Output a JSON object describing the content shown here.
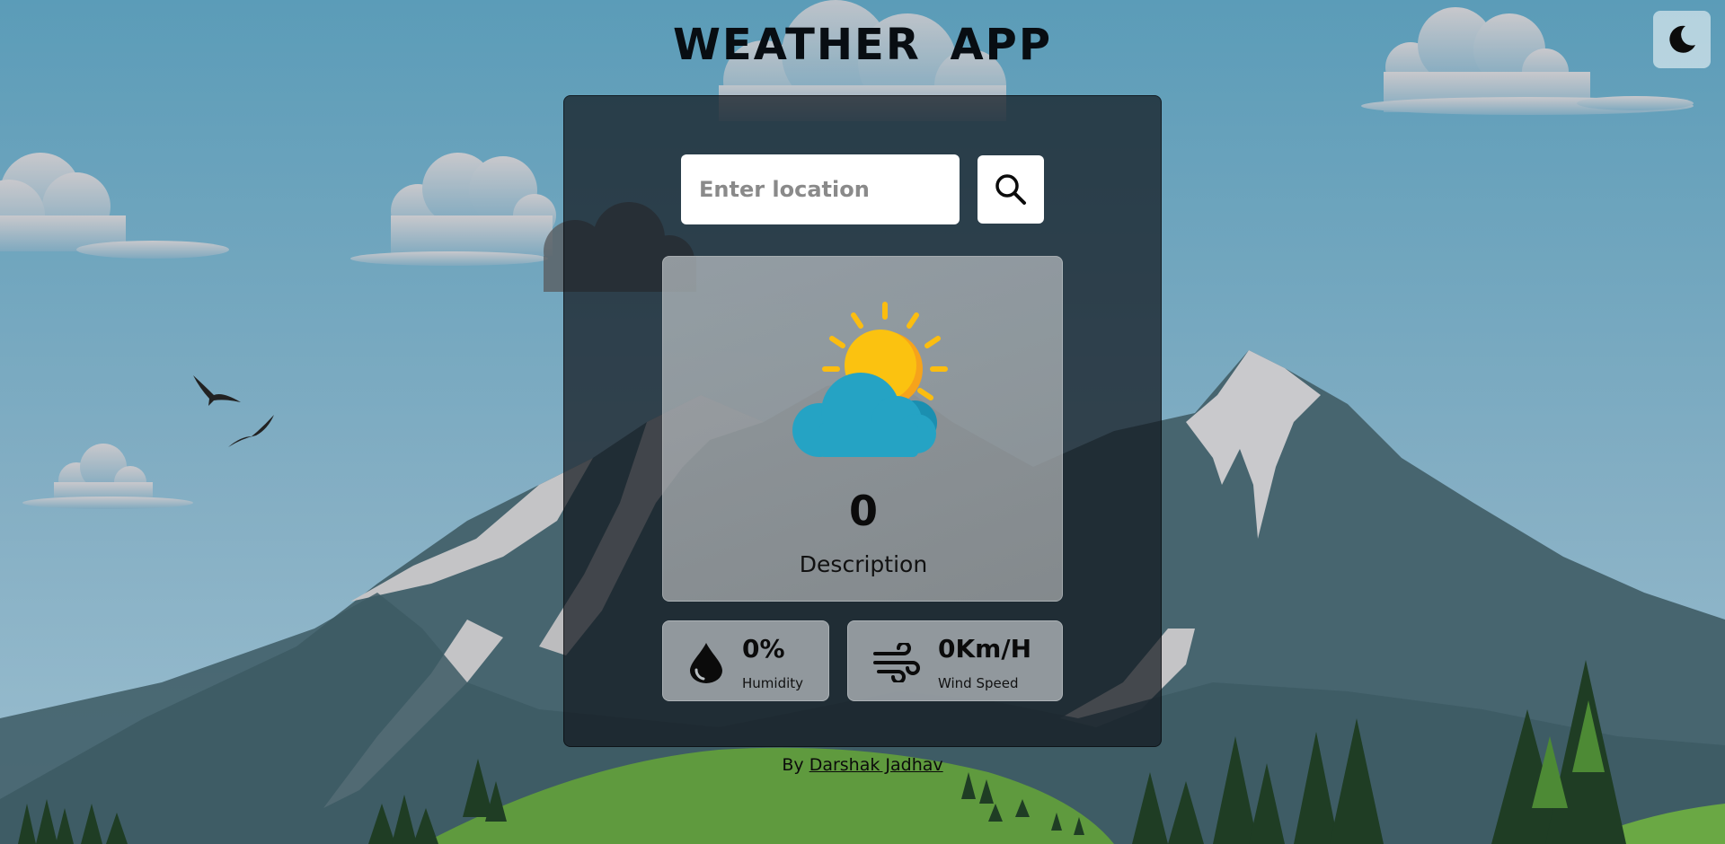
{
  "app": {
    "title": "WEATHER  APP"
  },
  "theme_toggle": {
    "icon": "moon-icon"
  },
  "search": {
    "placeholder": "Enter location",
    "value": "",
    "button_icon": "search-icon"
  },
  "weather": {
    "temperature": "0",
    "description": "Description",
    "icon": "partly-cloudy-icon"
  },
  "stats": {
    "humidity": {
      "value": "0%",
      "label": "Humidity",
      "icon": "water-drop-icon"
    },
    "wind": {
      "value": "0Km/H",
      "label": "Wind Speed",
      "icon": "wind-icon"
    }
  },
  "footer": {
    "prefix": "By ",
    "author": "Darshak Jadhav"
  },
  "colors": {
    "sky": "#6fa3bb",
    "panel": "#1a2229",
    "card": "#b8bec2",
    "sun": "#fbbd10",
    "cloud": "#21a0c0"
  }
}
